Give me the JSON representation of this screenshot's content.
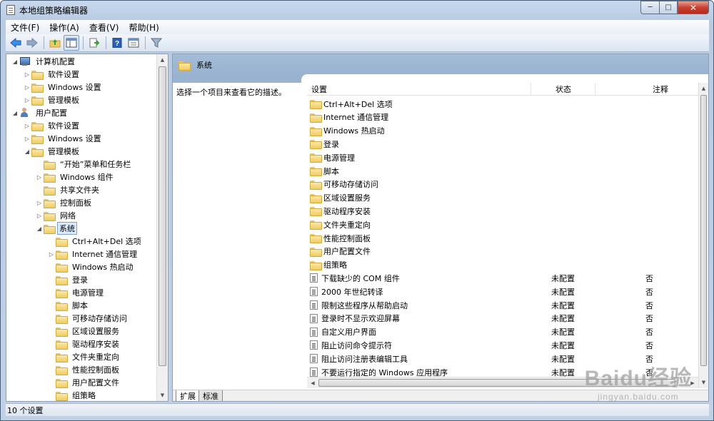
{
  "window": {
    "title": "本地组策略编辑器"
  },
  "menu": [
    "文件(F)",
    "操作(A)",
    "查看(V)",
    "帮助(H)"
  ],
  "toolbar": {
    "icons": [
      "back-arrow-icon",
      "forward-arrow-icon",
      "up-folder-icon",
      "show-hide-tree-icon",
      "export-list-icon",
      "help-icon",
      "properties-icon",
      "filter-icon"
    ]
  },
  "tree": {
    "computer_config": "计算机配置",
    "cc_software": "软件设置",
    "cc_windows": "Windows 设置",
    "cc_admin": "管理模板",
    "user_config": "用户配置",
    "uc_software": "软件设置",
    "uc_windows": "Windows 设置",
    "uc_admin": "管理模板",
    "start_menu": "“开始”菜单和任务栏",
    "windows_components": "Windows 组件",
    "shared_folders": "共享文件夹",
    "control_panel": "控制面板",
    "network": "网络",
    "system": "系统",
    "system_children": [
      "Ctrl+Alt+Del 选项",
      "Internet 通信管理",
      "Windows 热启动",
      "登录",
      "电源管理",
      "脚本",
      "可移动存储访问",
      "区域设置服务",
      "驱动程序安装",
      "文件夹重定向",
      "性能控制面板",
      "用户配置文件",
      "组策略"
    ]
  },
  "right": {
    "header": "系统",
    "description": "选择一个项目来查看它的描述。",
    "columns": {
      "setting": "设置",
      "status": "状态",
      "note": "注释"
    },
    "folders": [
      "Ctrl+Alt+Del 选项",
      "Internet 通信管理",
      "Windows 热启动",
      "登录",
      "电源管理",
      "脚本",
      "可移动存储访问",
      "区域设置服务",
      "驱动程序安装",
      "文件夹重定向",
      "性能控制面板",
      "用户配置文件",
      "组策略"
    ],
    "policies": [
      {
        "name": "下载缺少的 COM 组件",
        "status": "未配置",
        "note": "否"
      },
      {
        "name": "2000 年世纪转译",
        "status": "未配置",
        "note": "否"
      },
      {
        "name": "限制这些程序从帮助启动",
        "status": "未配置",
        "note": "否"
      },
      {
        "name": "登录时不显示欢迎屏幕",
        "status": "未配置",
        "note": "否"
      },
      {
        "name": "自定义用户界面",
        "status": "未配置",
        "note": "否"
      },
      {
        "name": "阻止访问命令提示符",
        "status": "未配置",
        "note": "否"
      },
      {
        "name": "阻止访问注册表编辑工具",
        "status": "未配置",
        "note": "否"
      },
      {
        "name": "不要运行指定的 Windows 应用程序",
        "status": "未配置",
        "note": "否"
      }
    ],
    "tabs": [
      "扩展",
      "标准"
    ]
  },
  "status_bar": "10 个设置",
  "watermark": {
    "main": "Baidu经验",
    "sub": "jingyan.baidu.com"
  }
}
